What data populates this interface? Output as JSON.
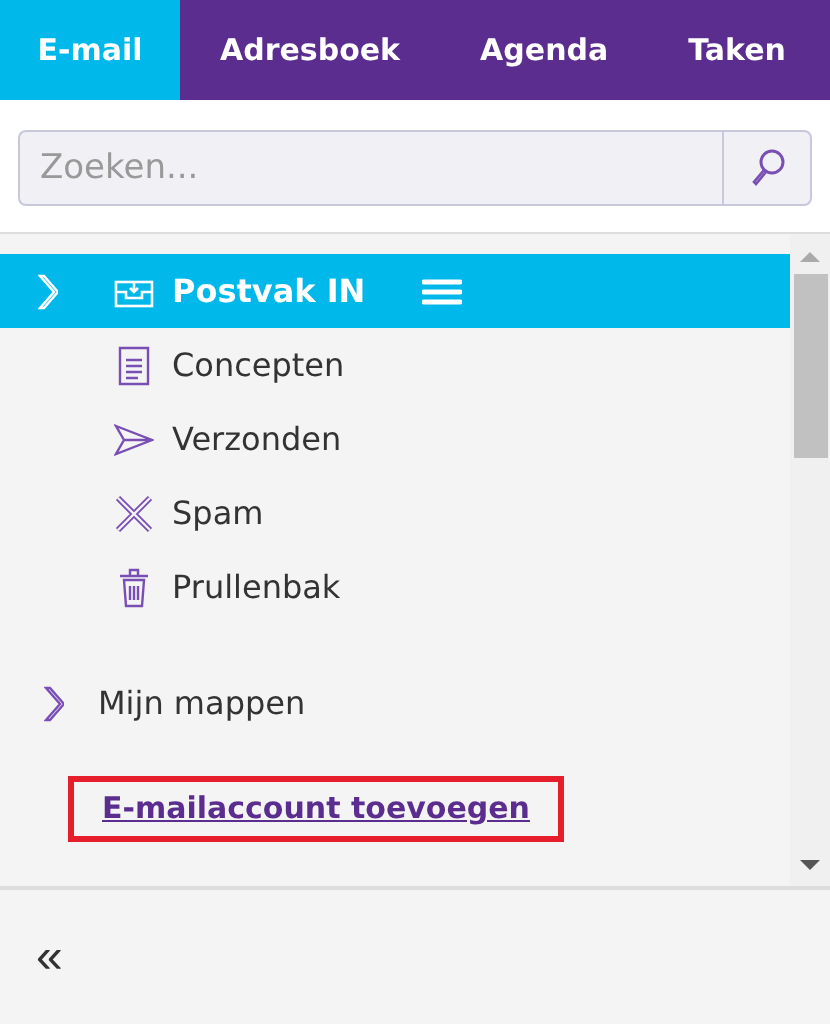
{
  "tabs": [
    {
      "label": "E-mail",
      "selected": true
    },
    {
      "label": "Adresboek",
      "selected": false
    },
    {
      "label": "Agenda",
      "selected": false
    },
    {
      "label": "Taken",
      "selected": false
    }
  ],
  "search": {
    "placeholder": "Zoeken..."
  },
  "folders": [
    {
      "label": "Postvak IN",
      "kind": "inbox",
      "selected": true,
      "expandable": true
    },
    {
      "label": "Concepten",
      "kind": "drafts",
      "selected": false,
      "expandable": false
    },
    {
      "label": "Verzonden",
      "kind": "sent",
      "selected": false,
      "expandable": false
    },
    {
      "label": "Spam",
      "kind": "spam",
      "selected": false,
      "expandable": false
    },
    {
      "label": "Prullenbak",
      "kind": "trash",
      "selected": false,
      "expandable": false
    }
  ],
  "my_folders": {
    "label": "Mijn mappen",
    "expanded": false
  },
  "add_account_link": {
    "label": "E-mailaccount toevoegen",
    "highlighted": true
  },
  "collapse_button": {
    "label": "«"
  }
}
